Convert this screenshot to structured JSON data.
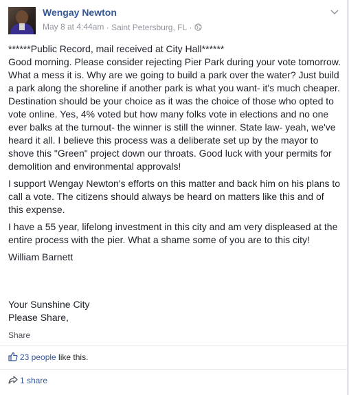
{
  "post": {
    "author": "Wengay Newton",
    "date": "May 8 at 4:44am",
    "separator": "·",
    "location": "Saint Petersburg, FL",
    "separator2": "·",
    "privacy_icon": "globe-icon",
    "menu_icon": "chevron-down-icon",
    "paragraphs": [
      "******Public Record, mail received at City Hall******",
      "Good morning. Please consider rejecting Pier Park during your vote tomorrow. What a mess it is. Why are we going to build a park over the water? Just build a park along the shoreline if another park is what you want- it's much cheaper. Destination should be your choice as it was the choice of those who opted to vote online. Yes, 4% voted but how many folks vote in elections and no one ever balks at the turnout- the winner is still the winner. State law- yeah, we've heard it all. I believe this process was a deliberate set up by the mayor to shove this \"Green\" project down our throats. Good luck with your permits for demolition and environmental approvals!",
      "I support Wengay Newton's efforts on this matter and back him on his plans to call a vote. The citizens should always be heard on matters like this and of this expense.",
      "I have a 55 year, lifelong investment in this city and am very displeased at the entire process with the pier. What a shame some of you are to this city!",
      "William Barnett",
      "Your Sunshine City",
      "Please Share,"
    ]
  },
  "actions": {
    "share_label": "Share"
  },
  "reactions": {
    "like_icon": "thumbs-up-icon",
    "people": "23 people",
    "suffix": " like this."
  },
  "shares": {
    "share_icon": "share-arrow-icon",
    "label": "1 share"
  },
  "colors": {
    "link": "#365899",
    "meta": "#90949c",
    "text": "#1d2129"
  }
}
